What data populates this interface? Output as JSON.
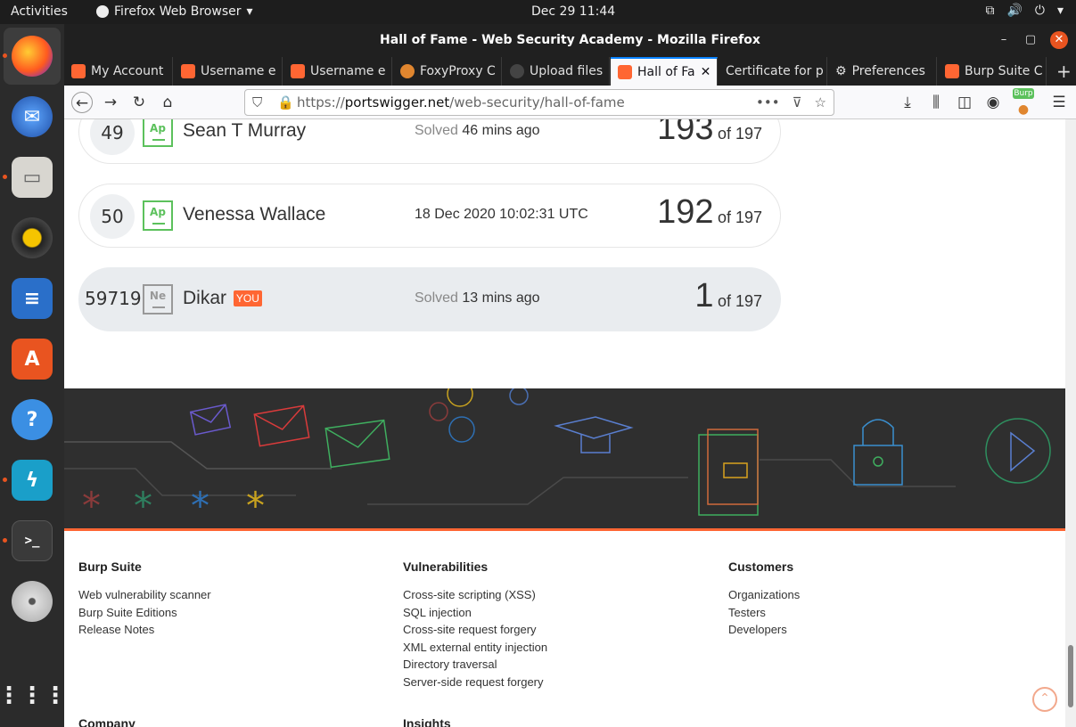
{
  "topbar": {
    "activities": "Activities",
    "app_menu": "Firefox Web Browser",
    "clock": "Dec 29  11:44"
  },
  "window": {
    "title": "Hall of Fame - Web Security Academy - Mozilla Firefox"
  },
  "tabs": [
    {
      "label": "My Account",
      "color": "#ff6633"
    },
    {
      "label": "Username e",
      "color": "#ff6633"
    },
    {
      "label": "Username e",
      "color": "#ff6633"
    },
    {
      "label": "FoxyProxy C",
      "color": "#e0862f"
    },
    {
      "label": "Upload files",
      "color": "#444444"
    },
    {
      "label": "Hall of Fa",
      "color": "#ff6633",
      "active": true
    },
    {
      "label": "Certificate for p",
      "color": ""
    },
    {
      "label": "Preferences",
      "color": ""
    },
    {
      "label": "Burp Suite C",
      "color": "#ff6633"
    }
  ],
  "navbar": {
    "url_domain": "portswigger.net",
    "url_prefix": "https://",
    "url_path": "/web-security/hall-of-fame",
    "burp_badge": "Burp"
  },
  "leaderboard": [
    {
      "rank": "49",
      "badge": "Ap",
      "name": "Sean T Murray",
      "solved_prefix": "Solved ",
      "solved_value": "46 mins ago",
      "score": "193",
      "of": "of 197",
      "you": false
    },
    {
      "rank": "50",
      "badge": "Ap",
      "name": "Venessa Wallace",
      "solved_prefix": "",
      "solved_value": "18 Dec 2020 10:02:31 UTC",
      "score": "192",
      "of": "of 197",
      "you": false
    },
    {
      "rank": "59719",
      "badge": "Ne",
      "name": "Dikar",
      "you_label": "YOU",
      "solved_prefix": "Solved ",
      "solved_value": "13 mins ago",
      "score": "1",
      "of": "of 197",
      "you": true
    }
  ],
  "footer": {
    "col1": {
      "title": "Burp Suite",
      "links": [
        "Web vulnerability scanner",
        "Burp Suite Editions",
        "Release Notes"
      ]
    },
    "col2": {
      "title": "Vulnerabilities",
      "links": [
        "Cross-site scripting (XSS)",
        "SQL injection",
        "Cross-site request forgery",
        "XML external entity injection",
        "Directory traversal",
        "Server-side request forgery"
      ]
    },
    "col3": {
      "title": "Customers",
      "links": [
        "Organizations",
        "Testers",
        "Developers"
      ]
    },
    "col4_title": "Company",
    "col5_title": "Insights"
  },
  "colors": {
    "accent": "#ff6633",
    "badge_green": "#5cc15c"
  }
}
